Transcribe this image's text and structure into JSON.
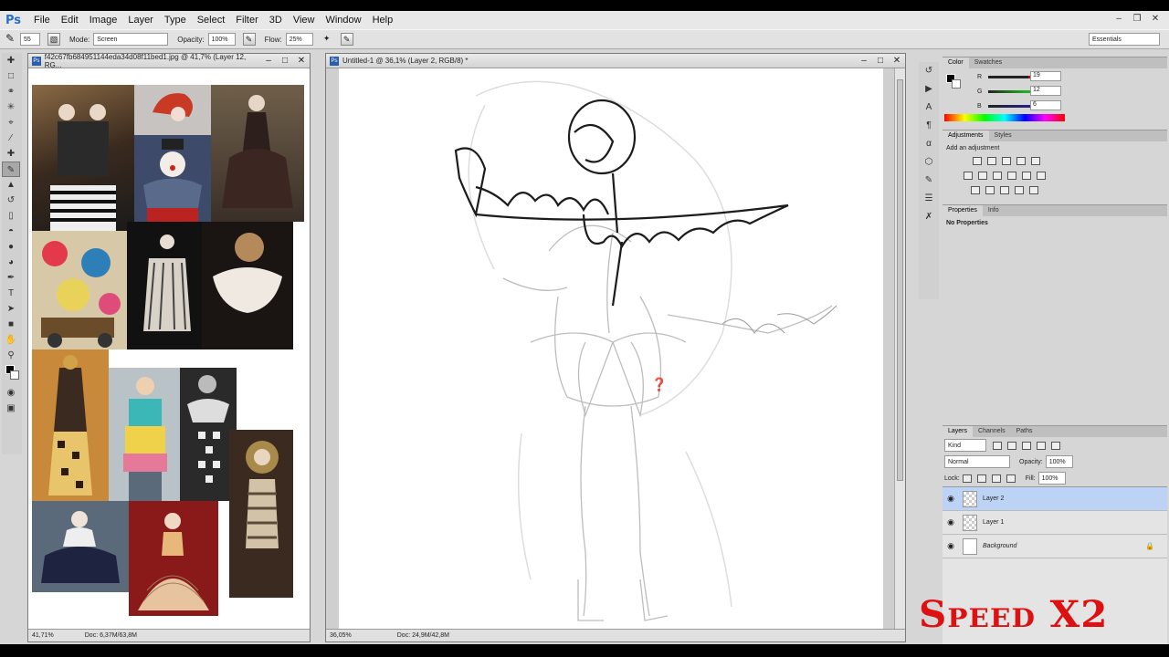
{
  "app": {
    "logo": "Ps"
  },
  "menu": [
    "File",
    "Edit",
    "Image",
    "Layer",
    "Type",
    "Select",
    "Filter",
    "3D",
    "View",
    "Window",
    "Help"
  ],
  "options": {
    "brush_size": "55",
    "mode_label": "Mode:",
    "mode_value": "Screen",
    "opacity_label": "Opacity:",
    "opacity_value": "100%",
    "flow_label": "Flow:",
    "flow_value": "25%",
    "workspace": "Essentials"
  },
  "doc1": {
    "title": "f42c67fb684951144eda34d08f11bed1.jpg @ 41,7% (Layer 12, RG...",
    "zoom": "41,71%",
    "info": "Doc: 6,37M/63,8M"
  },
  "doc2": {
    "title": "Untitled-1 @ 36,1% (Layer 2, RGB/8) *",
    "zoom": "36,05%",
    "info": "Doc: 24,9M/42,8M"
  },
  "color_panel": {
    "tabs": [
      "Color",
      "Swatches"
    ],
    "r_label": "R",
    "g_label": "G",
    "b_label": "B",
    "r": "19",
    "g": "12",
    "b": "6"
  },
  "adjustments": {
    "tabs": [
      "Adjustments",
      "Styles"
    ],
    "heading": "Add an adjustment"
  },
  "properties": {
    "tabs": [
      "Properties",
      "Info"
    ],
    "text": "No Properties"
  },
  "layers": {
    "tabs": [
      "Layers",
      "Channels",
      "Paths"
    ],
    "kind": "Kind",
    "blend": "Normal",
    "opacity_label": "Opacity:",
    "opacity": "100%",
    "lock_label": "Lock:",
    "fill_label": "Fill:",
    "fill": "100%",
    "items": [
      {
        "name": "Layer 2"
      },
      {
        "name": "Layer 1"
      },
      {
        "name": "Background"
      }
    ]
  },
  "overlay": {
    "speed": "Speed X2"
  },
  "colors": {
    "accent_red": "#d11111",
    "selection": "#bcd3f5"
  }
}
